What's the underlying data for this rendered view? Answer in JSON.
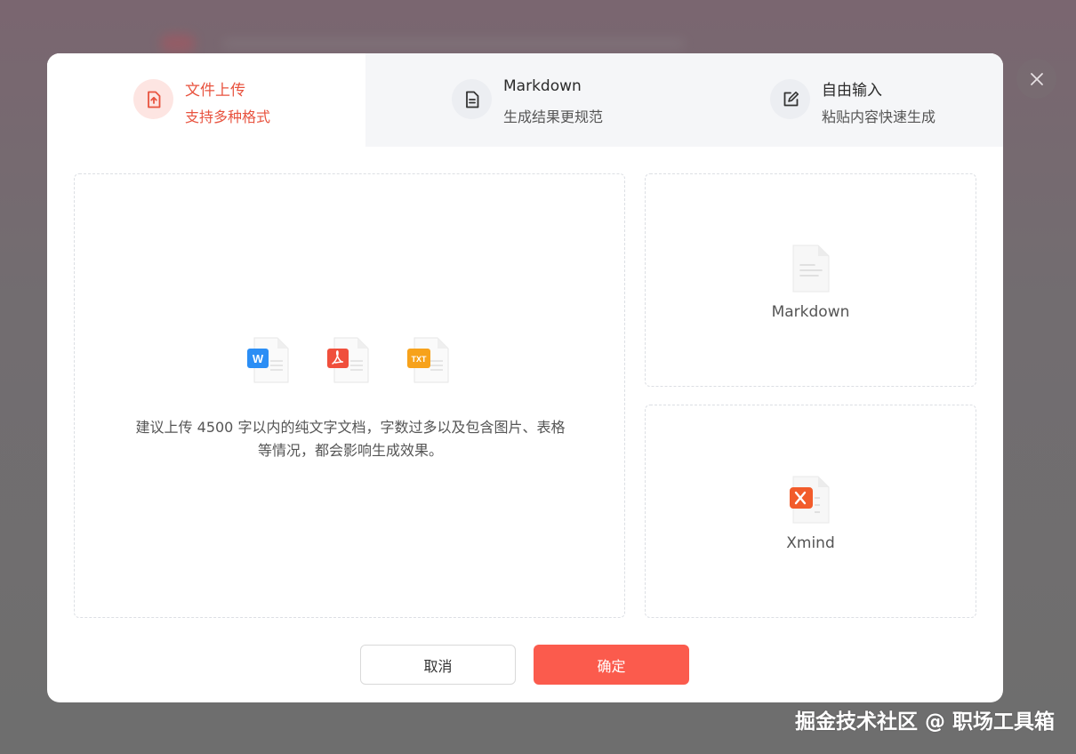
{
  "tabs": [
    {
      "title": "文件上传",
      "subtitle": "支持多种格式",
      "icon": "upload-file-icon",
      "active": true
    },
    {
      "title": "Markdown",
      "subtitle": "生成结果更规范",
      "icon": "document-icon",
      "active": false
    },
    {
      "title": "自由输入",
      "subtitle": "粘贴内容快速生成",
      "icon": "edit-icon",
      "active": false
    }
  ],
  "upload": {
    "file_types": [
      "W",
      "PDF",
      "TXT"
    ],
    "hint_line1": "建议上传 4500 字以内的纯文字文档，字数过多以及包含图片、表格",
    "hint_line2": "等情况，都会影响生成效果。"
  },
  "formats": {
    "markdown_label": "Markdown",
    "xmind_label": "Xmind"
  },
  "buttons": {
    "cancel": "取消",
    "confirm": "确定"
  },
  "watermark": "掘金技术社区 @ 职场工具箱",
  "colors": {
    "accent": "#fb5b4d",
    "active_tab_text": "#e8533f",
    "word_blue": "#2b8ef5",
    "pdf_red": "#f04f3c",
    "txt_orange": "#f7a21b",
    "xmind_red": "#f25c2b"
  }
}
